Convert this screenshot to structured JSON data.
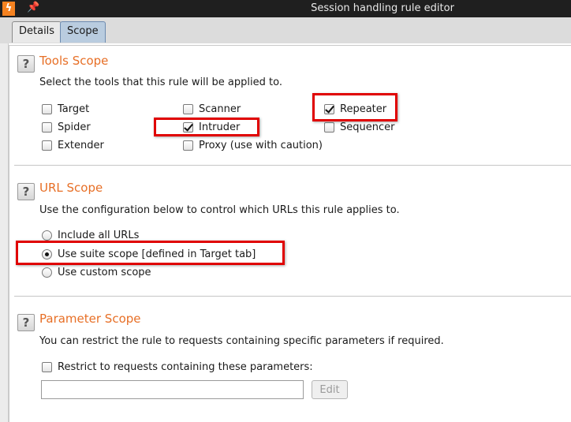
{
  "window": {
    "title": "Session handling rule editor",
    "logo_glyph": "ϟ"
  },
  "tabs": [
    {
      "label": "Details"
    },
    {
      "label": "Scope"
    }
  ],
  "tools_scope": {
    "title": "Tools Scope",
    "description": "Select the tools that this rule will be applied to.",
    "tools": [
      {
        "label": "Target",
        "checked": false
      },
      {
        "label": "Spider",
        "checked": false
      },
      {
        "label": "Extender",
        "checked": false
      },
      {
        "label": "Scanner",
        "checked": false
      },
      {
        "label": "Intruder",
        "checked": true
      },
      {
        "label": "Proxy (use with caution)",
        "checked": false
      },
      {
        "label": "Repeater",
        "checked": true
      },
      {
        "label": "Sequencer",
        "checked": false
      }
    ]
  },
  "url_scope": {
    "title": "URL Scope",
    "description": "Use the configuration below to control which URLs this rule applies to.",
    "options": [
      {
        "label": "Include all URLs",
        "selected": false
      },
      {
        "label": "Use suite scope [defined in Target tab]",
        "selected": true
      },
      {
        "label": "Use custom scope",
        "selected": false
      }
    ]
  },
  "parameter_scope": {
    "title": "Parameter Scope",
    "description": "You can restrict the rule to requests containing specific parameters if required.",
    "restrict_label": "Restrict to requests containing these parameters:",
    "restrict_checked": false,
    "input_value": "",
    "edit_label": "Edit"
  },
  "help_glyph": "?",
  "colors": {
    "section_title": "#e76f26",
    "highlight": "#e00000",
    "active_tab": "#b9ccdf"
  }
}
